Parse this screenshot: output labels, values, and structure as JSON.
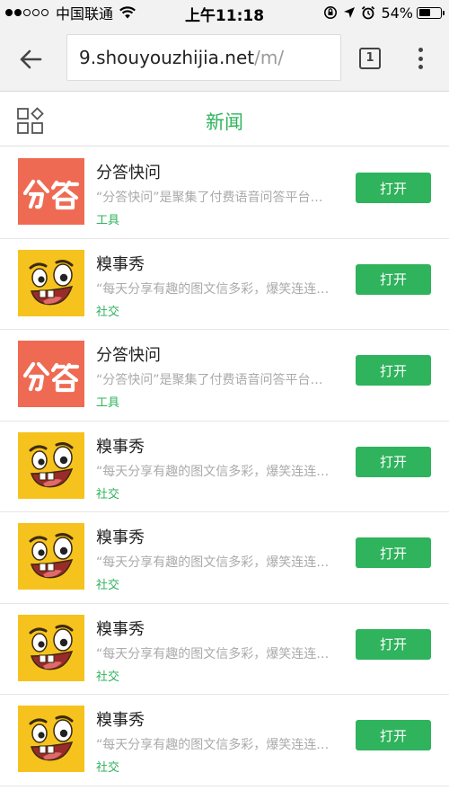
{
  "status_bar": {
    "carrier": "中国联通",
    "time": "上午11:18",
    "battery": "54%",
    "battery_level": 0.54
  },
  "browser": {
    "url_host": "9.shouyouzhijia.net",
    "url_path": "/m/",
    "tab_count": "1"
  },
  "page": {
    "title": "新闻"
  },
  "apps": [
    {
      "name": "分答快问",
      "desc": "“分答快问”是聚集了付费语音问答平台…",
      "category": "工具",
      "button": "打开",
      "icon": "fenda-logo-icon",
      "color": "#ef6a52"
    },
    {
      "name": "糗事秀",
      "desc": "“每天分享有趣的图文信多彩，爆笑连连…",
      "category": "社交",
      "button": "打开",
      "icon": "funny-face-icon",
      "color": "#f6c21d"
    },
    {
      "name": "分答快问",
      "desc": "“分答快问”是聚集了付费语音问答平台…",
      "category": "工具",
      "button": "打开",
      "icon": "fenda-logo-icon",
      "color": "#ef6a52"
    },
    {
      "name": "糗事秀",
      "desc": "“每天分享有趣的图文信多彩，爆笑连连…",
      "category": "社交",
      "button": "打开",
      "icon": "funny-face-icon",
      "color": "#f6c21d"
    },
    {
      "name": "糗事秀",
      "desc": "“每天分享有趣的图文信多彩，爆笑连连…",
      "category": "社交",
      "button": "打开",
      "icon": "funny-face-icon",
      "color": "#f6c21d"
    },
    {
      "name": "糗事秀",
      "desc": "“每天分享有趣的图文信多彩，爆笑连连…",
      "category": "社交",
      "button": "打开",
      "icon": "funny-face-icon",
      "color": "#f6c21d"
    },
    {
      "name": "糗事秀",
      "desc": "“每天分享有趣的图文信多彩，爆笑连连…",
      "category": "社交",
      "button": "打开",
      "icon": "funny-face-icon",
      "color": "#f6c21d"
    }
  ]
}
